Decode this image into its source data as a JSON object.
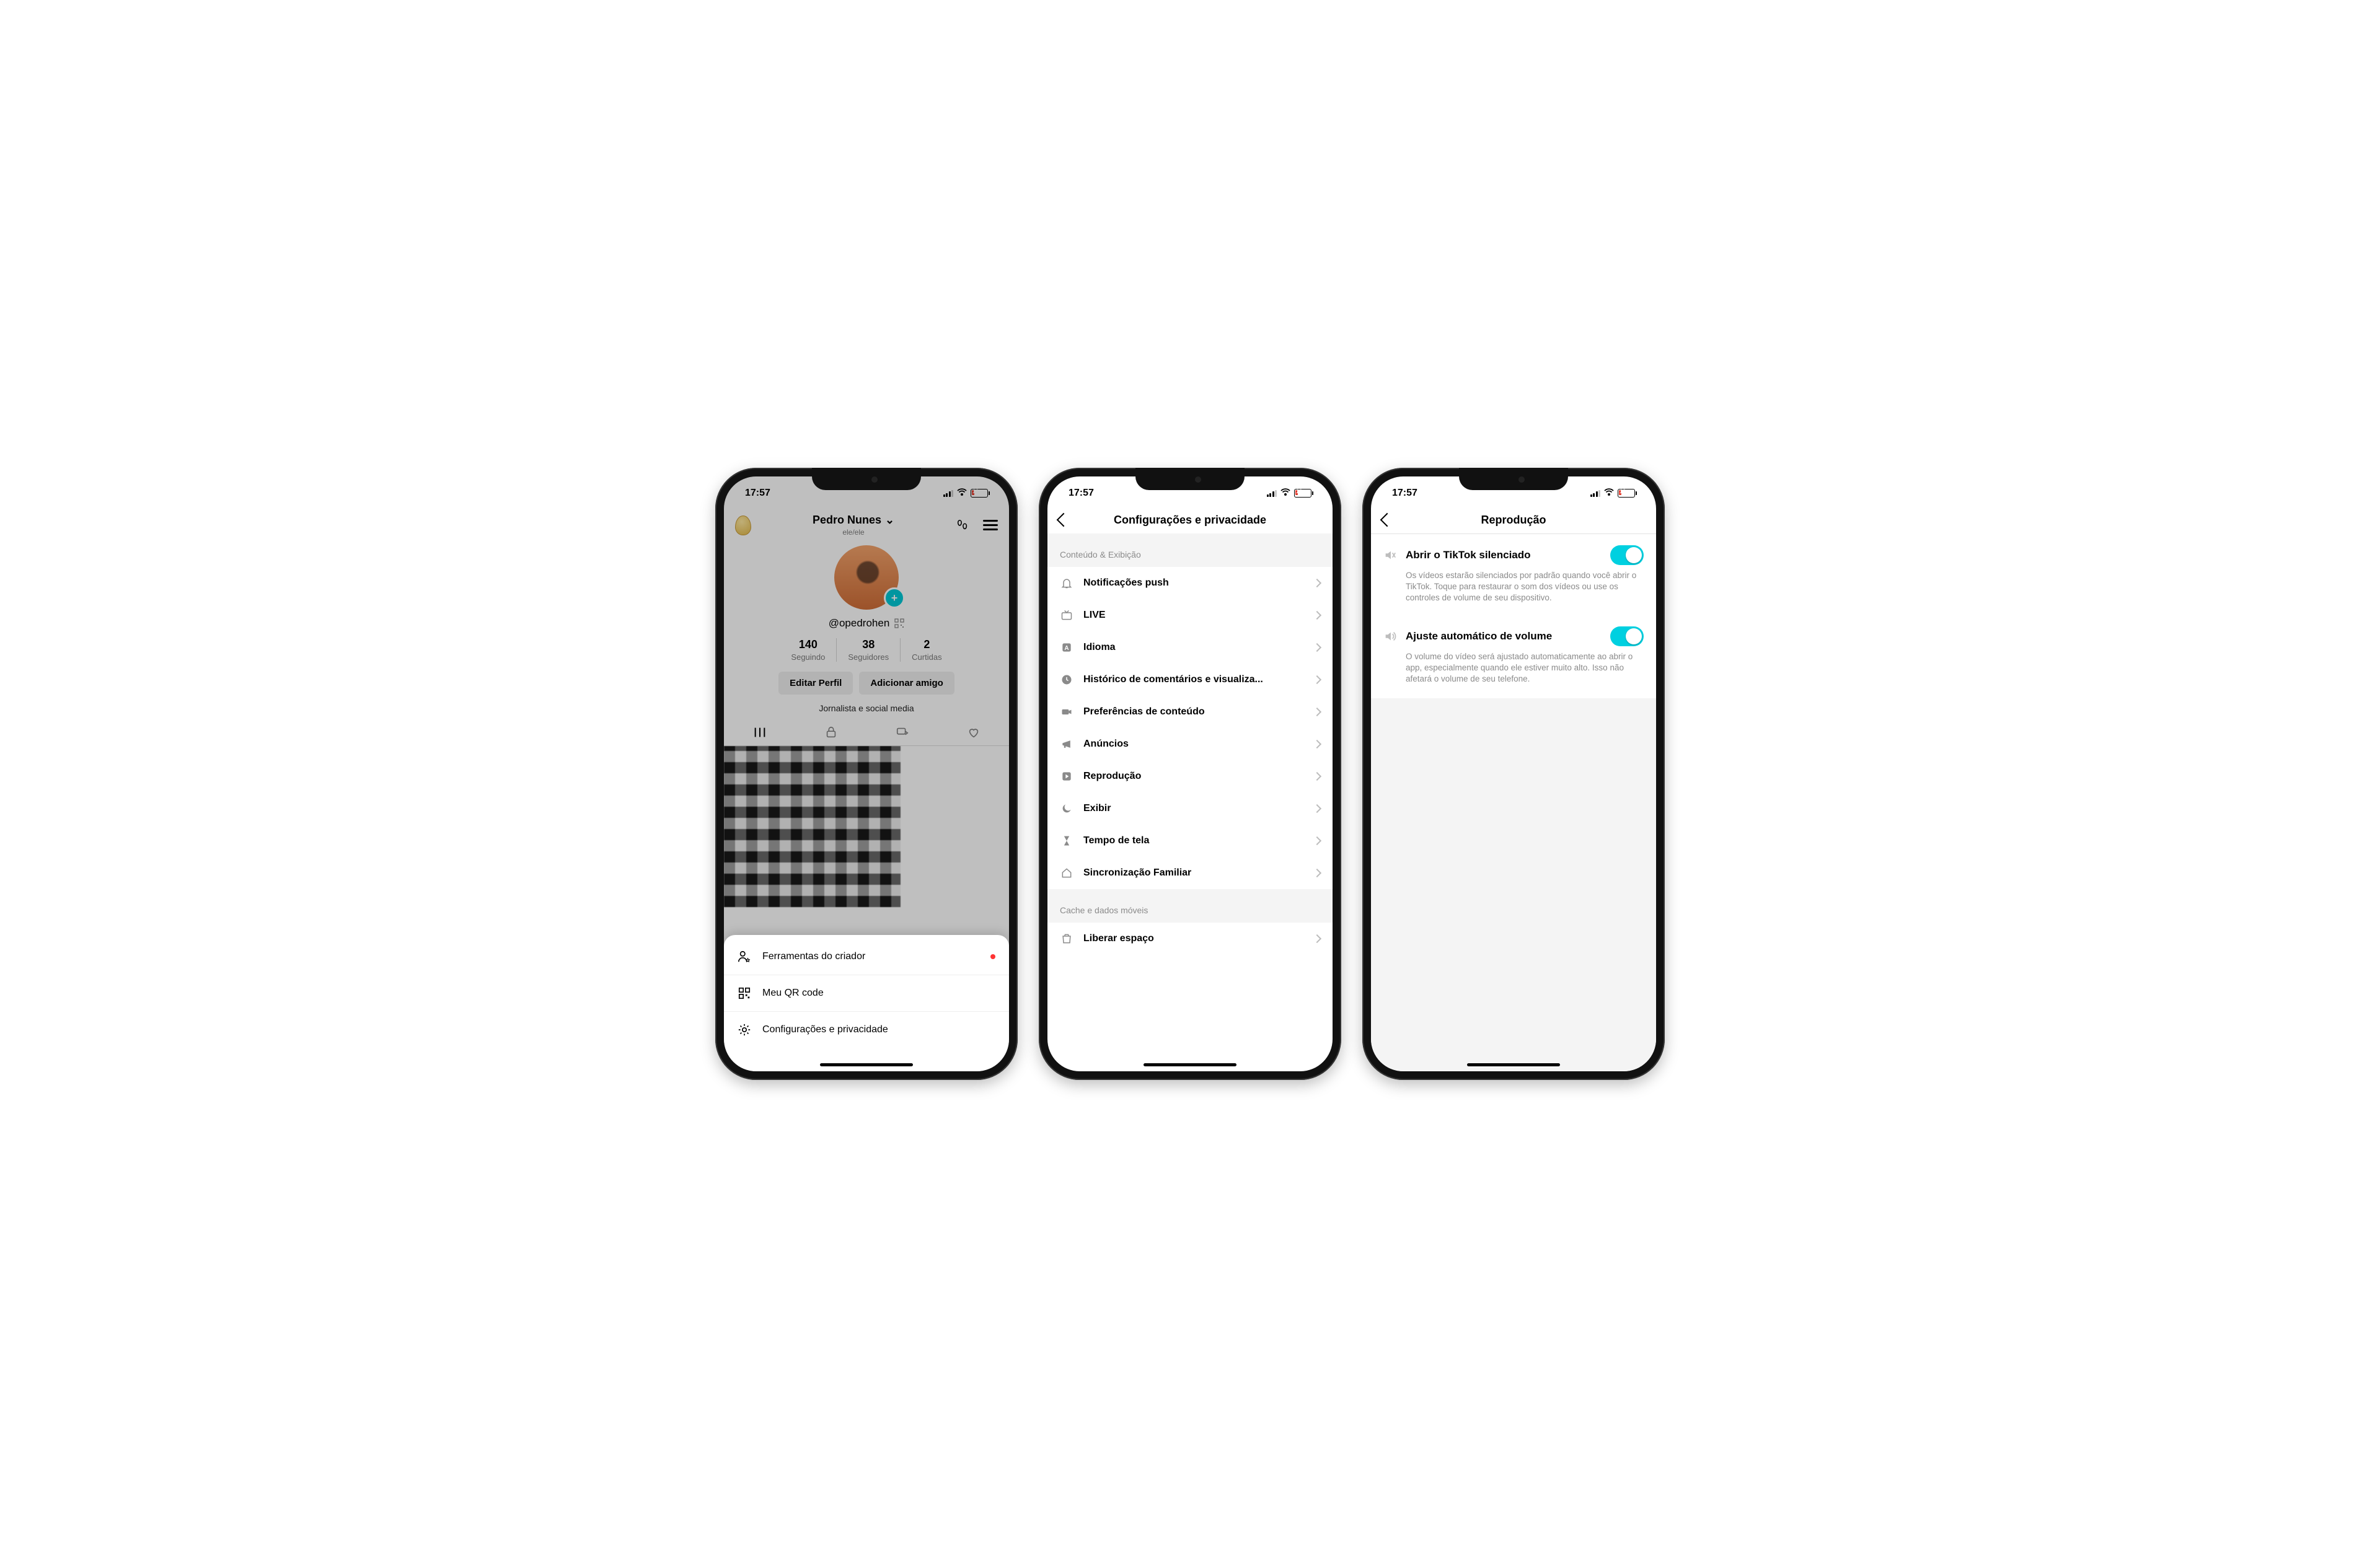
{
  "status": {
    "time": "17:57",
    "battery_pct": "16"
  },
  "colors": {
    "accent": "#00d0e0",
    "battery_low": "#e23b2e",
    "notif_dot": "#f33"
  },
  "p1": {
    "display_name": "Pedro Nunes",
    "pronouns": "ele/ele",
    "handle": "@opedrohen",
    "stats": [
      {
        "value": "140",
        "label": "Seguindo"
      },
      {
        "value": "38",
        "label": "Seguidores"
      },
      {
        "value": "2",
        "label": "Curtidas"
      }
    ],
    "edit_btn": "Editar Perfil",
    "add_friend_btn": "Adicionar amigo",
    "bio": "Jornalista e social media",
    "sheet": [
      {
        "label": "Ferramentas do criador",
        "icon": "person-star",
        "badge": true
      },
      {
        "label": "Meu QR code",
        "icon": "qr",
        "badge": false
      },
      {
        "label": "Configurações e privacidade",
        "icon": "gear",
        "badge": false
      }
    ]
  },
  "p2": {
    "title": "Configurações e privacidade",
    "section1": "Conteúdo & Exibição",
    "items": [
      {
        "label": "Notificações push",
        "icon": "bell"
      },
      {
        "label": "LIVE",
        "icon": "tv"
      },
      {
        "label": "Idioma",
        "icon": "lang"
      },
      {
        "label": "Histórico de comentários e visualiza...",
        "icon": "clock"
      },
      {
        "label": "Preferências de conteúdo",
        "icon": "camera"
      },
      {
        "label": "Anúncios",
        "icon": "megaphone"
      },
      {
        "label": "Reprodução",
        "icon": "play"
      },
      {
        "label": "Exibir",
        "icon": "moon"
      },
      {
        "label": "Tempo de tela",
        "icon": "hourglass"
      },
      {
        "label": "Sincronização Familiar",
        "icon": "home"
      }
    ],
    "section2": "Cache e dados móveis",
    "items2": [
      {
        "label": "Liberar espaço",
        "icon": "trash"
      }
    ]
  },
  "p3": {
    "title": "Reprodução",
    "opt1": {
      "title": "Abrir o TikTok silenciado",
      "desc": "Os vídeos estarão silenciados por padrão quando você abrir o TikTok. Toque para restaurar o som dos vídeos ou use os controles de volume de seu dispositivo.",
      "on": true
    },
    "opt2": {
      "title": "Ajuste automático de volume",
      "desc": "O volume do vídeo será ajustado automaticamente ao abrir o app, especialmente quando ele estiver muito alto. Isso não afetará o volume de seu telefone.",
      "on": true
    }
  }
}
